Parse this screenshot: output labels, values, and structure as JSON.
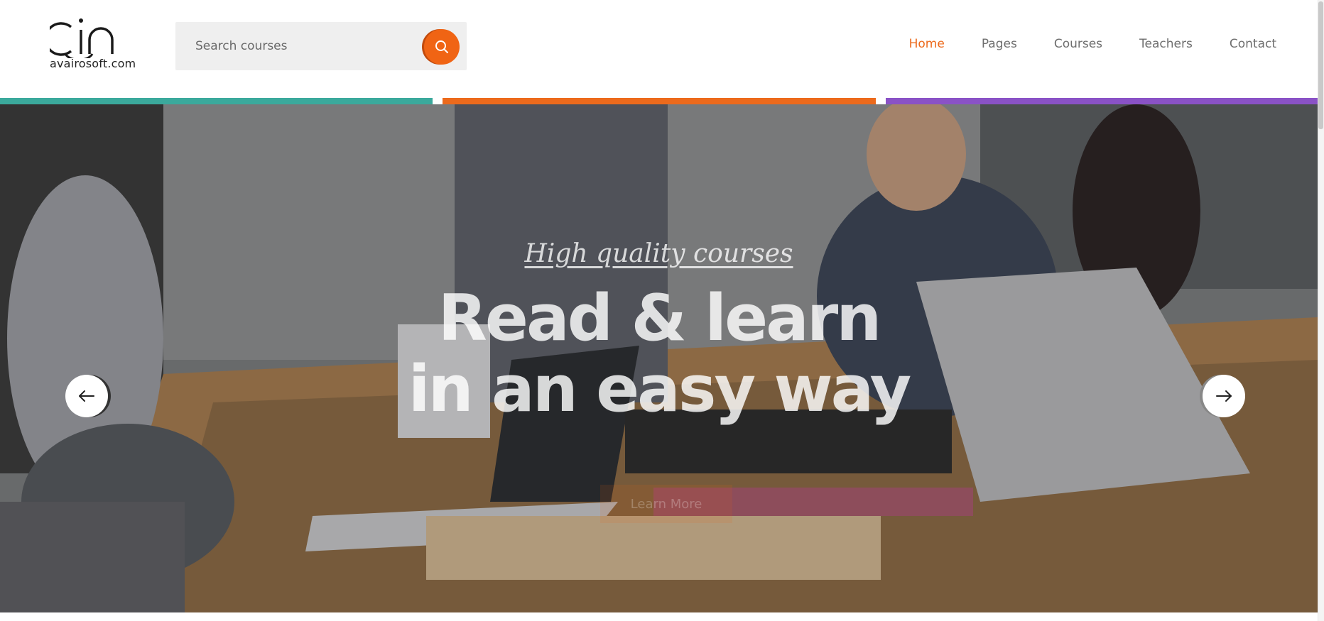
{
  "brand": {
    "logo_text": "avairosoft.com"
  },
  "search": {
    "placeholder": "Search courses"
  },
  "nav": {
    "items": [
      {
        "label": "Home",
        "active": true
      },
      {
        "label": "Pages",
        "active": false
      },
      {
        "label": "Courses",
        "active": false
      },
      {
        "label": "Teachers",
        "active": false
      },
      {
        "label": "Contact",
        "active": false
      }
    ]
  },
  "accent_bars": [
    "#3ba99c",
    "#ec6a1c",
    "#8a52c6"
  ],
  "hero": {
    "eyebrow": "High quality courses",
    "title_line1": "Read & learn",
    "title_line2": "in an easy way",
    "button_label": "Learn More"
  },
  "icons": {
    "search": "search-icon",
    "prev": "arrow-left-icon",
    "next": "arrow-right-icon"
  },
  "colors": {
    "accent": "#ec6a1c"
  }
}
